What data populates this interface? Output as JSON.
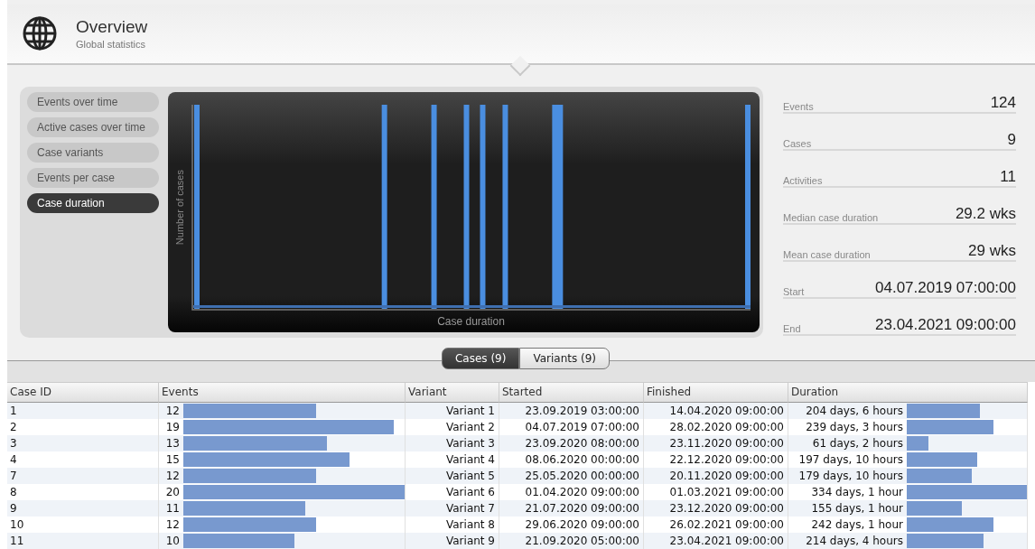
{
  "header": {
    "title": "Overview",
    "subtitle": "Global statistics"
  },
  "chart_menu": [
    {
      "label": "Events over time",
      "selected": false
    },
    {
      "label": "Active cases over time",
      "selected": false
    },
    {
      "label": "Case variants",
      "selected": false
    },
    {
      "label": "Events per case",
      "selected": false
    },
    {
      "label": "Case duration",
      "selected": true
    }
  ],
  "chart": {
    "ylabel": "Number of cases",
    "xlabel": "Case duration"
  },
  "stats": [
    {
      "label": "Events",
      "value": "124"
    },
    {
      "label": "Cases",
      "value": "9"
    },
    {
      "label": "Activities",
      "value": "11"
    },
    {
      "label": "Median case duration",
      "value": "29.2 wks"
    },
    {
      "label": "Mean case duration",
      "value": "29 wks"
    },
    {
      "label": "Start",
      "value": "04.07.2019 07:00:00"
    },
    {
      "label": "End",
      "value": "23.04.2021 09:00:00"
    }
  ],
  "tabs": [
    {
      "label": "Cases (9)",
      "selected": true
    },
    {
      "label": "Variants (9)",
      "selected": false
    }
  ],
  "table": {
    "columns": [
      "Case ID",
      "Events",
      "Variant",
      "Started",
      "Finished",
      "Duration"
    ],
    "rows": [
      {
        "case_id": "1",
        "events": "12",
        "variant": "Variant 1",
        "started": "23.09.2019 03:00:00",
        "finished": "14.04.2020 09:00:00",
        "duration": "204 days, 6 hours"
      },
      {
        "case_id": "2",
        "events": "19",
        "variant": "Variant 2",
        "started": "04.07.2019 07:00:00",
        "finished": "28.02.2020 09:00:00",
        "duration": "239 days, 3 hours"
      },
      {
        "case_id": "3",
        "events": "13",
        "variant": "Variant 3",
        "started": "23.09.2020 08:00:00",
        "finished": "23.11.2020 09:00:00",
        "duration": "61 days, 2 hours"
      },
      {
        "case_id": "4",
        "events": "15",
        "variant": "Variant 4",
        "started": "08.06.2020 00:00:00",
        "finished": "22.12.2020 09:00:00",
        "duration": "197 days, 10 hours"
      },
      {
        "case_id": "7",
        "events": "12",
        "variant": "Variant 5",
        "started": "25.05.2020 00:00:00",
        "finished": "20.11.2020 09:00:00",
        "duration": "179 days, 10 hours"
      },
      {
        "case_id": "8",
        "events": "20",
        "variant": "Variant 6",
        "started": "01.04.2020 09:00:00",
        "finished": "01.03.2021 09:00:00",
        "duration": "334 days, 1 hour"
      },
      {
        "case_id": "9",
        "events": "11",
        "variant": "Variant 7",
        "started": "21.07.2020 09:00:00",
        "finished": "23.12.2020 09:00:00",
        "duration": "155 days, 1 hour"
      },
      {
        "case_id": "10",
        "events": "12",
        "variant": "Variant 8",
        "started": "29.06.2020 09:00:00",
        "finished": "26.02.2021 09:00:00",
        "duration": "242 days, 1 hour"
      },
      {
        "case_id": "11",
        "events": "10",
        "variant": "Variant 9",
        "started": "21.09.2020 05:00:00",
        "finished": "23.04.2021 09:00:00",
        "duration": "214 days, 4 hours"
      }
    ]
  }
}
